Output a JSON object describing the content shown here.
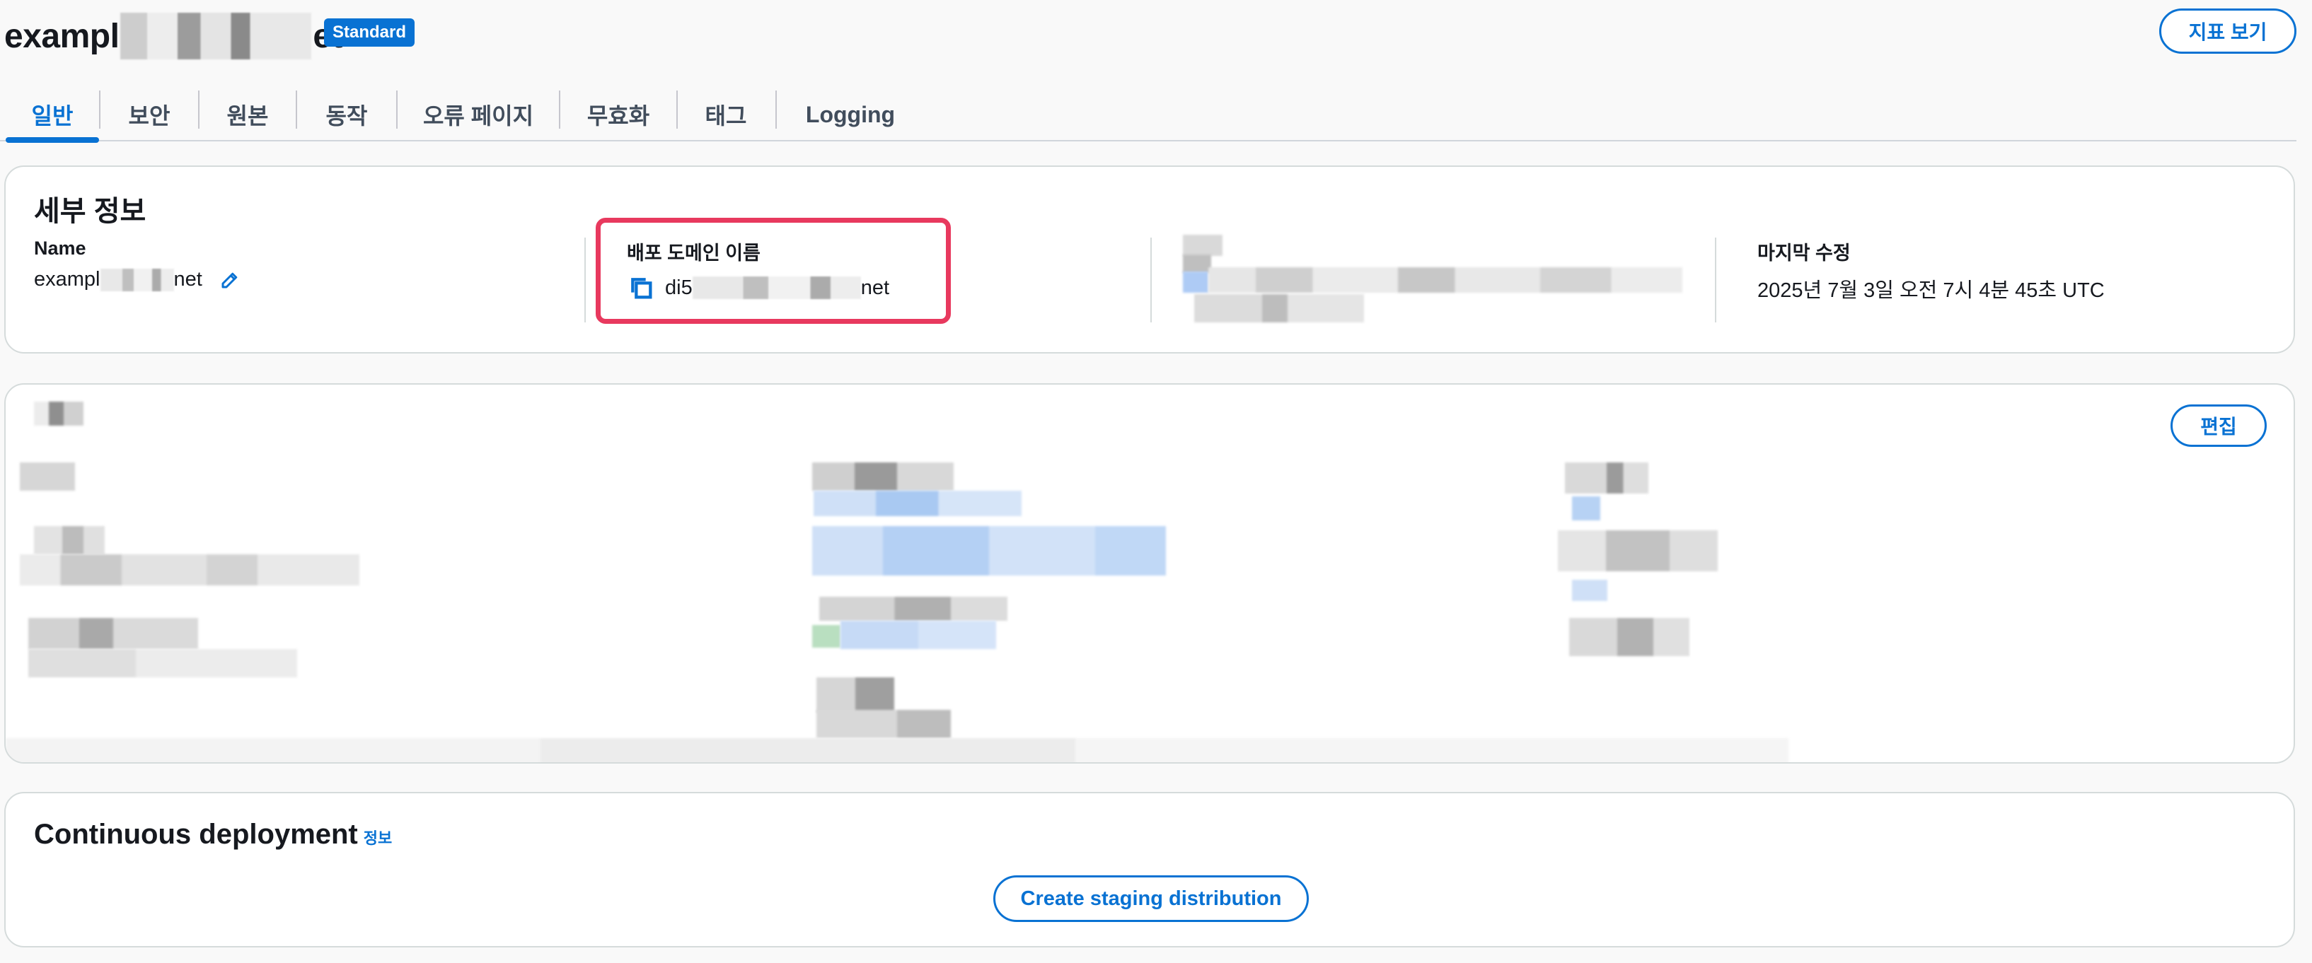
{
  "header": {
    "title_prefix": "exampl",
    "title_suffix": "et",
    "badge": "Standard",
    "metrics_button": "지표 보기"
  },
  "tabs": [
    {
      "label": "일반",
      "active": true
    },
    {
      "label": "보안"
    },
    {
      "label": "원본"
    },
    {
      "label": "동작"
    },
    {
      "label": "오류 페이지"
    },
    {
      "label": "무효화"
    },
    {
      "label": "태그"
    },
    {
      "label": "Logging"
    }
  ],
  "details": {
    "title": "세부 정보",
    "name_label": "Name",
    "name_prefix": "exampl",
    "name_suffix": "net",
    "domain_label": "배포 도메인 이름",
    "domain_prefix": "di5",
    "domain_suffix": "net",
    "modified_label": "마지막 수정",
    "modified_value": "2025년 7월 3일 오전 7시 4분 45초 UTC"
  },
  "settings": {
    "edit_button": "편집"
  },
  "continuous_deployment": {
    "title": "Continuous deployment",
    "info_link": "정보",
    "staging_button": "Create staging distribution"
  },
  "colors": {
    "accent": "#0972d3",
    "highlight": "#e8395e",
    "border": "#d5dbdb"
  },
  "icons": [
    "copy-icon",
    "pencil-icon"
  ]
}
